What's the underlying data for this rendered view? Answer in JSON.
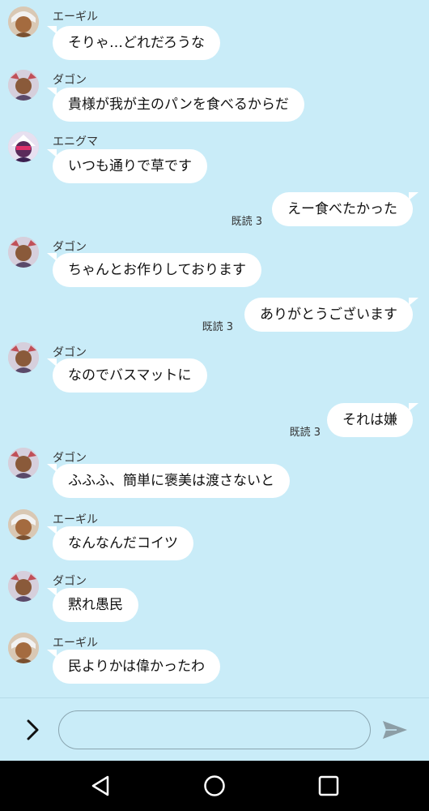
{
  "messages": [
    {
      "side": "in",
      "sender": "エーギル",
      "avatar": "egil",
      "text": "そりゃ…どれだろうな"
    },
    {
      "side": "in",
      "sender": "ダゴン",
      "avatar": "dagon",
      "text": "貴様が我が主のパンを食べるからだ"
    },
    {
      "side": "in",
      "sender": "エニグマ",
      "avatar": "enigma",
      "text": "いつも通りで草です"
    },
    {
      "side": "out",
      "read": "既読 3",
      "text": "えー食べたかった"
    },
    {
      "side": "in",
      "sender": "ダゴン",
      "avatar": "dagon",
      "text": "ちゃんとお作りしております"
    },
    {
      "side": "out",
      "read": "既読 3",
      "text": "ありがとうございます"
    },
    {
      "side": "in",
      "sender": "ダゴン",
      "avatar": "dagon",
      "text": "なのでバスマットに"
    },
    {
      "side": "out",
      "read": "既読 3",
      "text": "それは嫌"
    },
    {
      "side": "in",
      "sender": "ダゴン",
      "avatar": "dagon",
      "text": "ふふふ、簡単に褒美は渡さないと"
    },
    {
      "side": "in",
      "sender": "エーギル",
      "avatar": "egil",
      "text": "なんなんだコイツ"
    },
    {
      "side": "in",
      "sender": "ダゴン",
      "avatar": "dagon",
      "text": "黙れ愚民"
    },
    {
      "side": "in",
      "sender": "エーギル",
      "avatar": "egil",
      "text": "民よりかは偉かったわ"
    }
  ],
  "composer": {
    "expand_icon": "chevron-right-icon",
    "input_value": "",
    "send_icon": "send-icon"
  },
  "navbar": {
    "back_icon": "back-triangle-icon",
    "home_icon": "home-circle-icon",
    "recents_icon": "recents-square-icon"
  },
  "colors": {
    "background": "#c9ecf8",
    "bubble": "#ffffff",
    "navbar": "#000000"
  }
}
